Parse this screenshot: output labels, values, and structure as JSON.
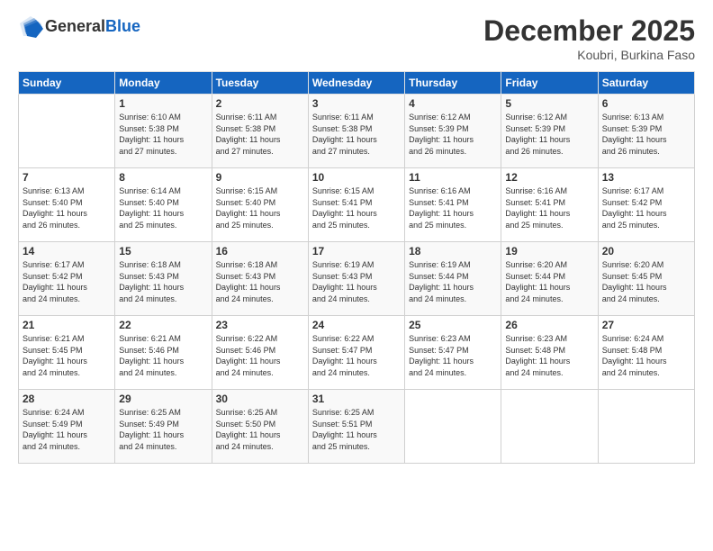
{
  "logo": {
    "general": "General",
    "blue": "Blue"
  },
  "header": {
    "month": "December 2025",
    "location": "Koubri, Burkina Faso"
  },
  "weekdays": [
    "Sunday",
    "Monday",
    "Tuesday",
    "Wednesday",
    "Thursday",
    "Friday",
    "Saturday"
  ],
  "weeks": [
    [
      {
        "day": "",
        "info": ""
      },
      {
        "day": "1",
        "info": "Sunrise: 6:10 AM\nSunset: 5:38 PM\nDaylight: 11 hours\nand 27 minutes."
      },
      {
        "day": "2",
        "info": "Sunrise: 6:11 AM\nSunset: 5:38 PM\nDaylight: 11 hours\nand 27 minutes."
      },
      {
        "day": "3",
        "info": "Sunrise: 6:11 AM\nSunset: 5:38 PM\nDaylight: 11 hours\nand 27 minutes."
      },
      {
        "day": "4",
        "info": "Sunrise: 6:12 AM\nSunset: 5:39 PM\nDaylight: 11 hours\nand 26 minutes."
      },
      {
        "day": "5",
        "info": "Sunrise: 6:12 AM\nSunset: 5:39 PM\nDaylight: 11 hours\nand 26 minutes."
      },
      {
        "day": "6",
        "info": "Sunrise: 6:13 AM\nSunset: 5:39 PM\nDaylight: 11 hours\nand 26 minutes."
      }
    ],
    [
      {
        "day": "7",
        "info": "Sunrise: 6:13 AM\nSunset: 5:40 PM\nDaylight: 11 hours\nand 26 minutes."
      },
      {
        "day": "8",
        "info": "Sunrise: 6:14 AM\nSunset: 5:40 PM\nDaylight: 11 hours\nand 25 minutes."
      },
      {
        "day": "9",
        "info": "Sunrise: 6:15 AM\nSunset: 5:40 PM\nDaylight: 11 hours\nand 25 minutes."
      },
      {
        "day": "10",
        "info": "Sunrise: 6:15 AM\nSunset: 5:41 PM\nDaylight: 11 hours\nand 25 minutes."
      },
      {
        "day": "11",
        "info": "Sunrise: 6:16 AM\nSunset: 5:41 PM\nDaylight: 11 hours\nand 25 minutes."
      },
      {
        "day": "12",
        "info": "Sunrise: 6:16 AM\nSunset: 5:41 PM\nDaylight: 11 hours\nand 25 minutes."
      },
      {
        "day": "13",
        "info": "Sunrise: 6:17 AM\nSunset: 5:42 PM\nDaylight: 11 hours\nand 25 minutes."
      }
    ],
    [
      {
        "day": "14",
        "info": "Sunrise: 6:17 AM\nSunset: 5:42 PM\nDaylight: 11 hours\nand 24 minutes."
      },
      {
        "day": "15",
        "info": "Sunrise: 6:18 AM\nSunset: 5:43 PM\nDaylight: 11 hours\nand 24 minutes."
      },
      {
        "day": "16",
        "info": "Sunrise: 6:18 AM\nSunset: 5:43 PM\nDaylight: 11 hours\nand 24 minutes."
      },
      {
        "day": "17",
        "info": "Sunrise: 6:19 AM\nSunset: 5:43 PM\nDaylight: 11 hours\nand 24 minutes."
      },
      {
        "day": "18",
        "info": "Sunrise: 6:19 AM\nSunset: 5:44 PM\nDaylight: 11 hours\nand 24 minutes."
      },
      {
        "day": "19",
        "info": "Sunrise: 6:20 AM\nSunset: 5:44 PM\nDaylight: 11 hours\nand 24 minutes."
      },
      {
        "day": "20",
        "info": "Sunrise: 6:20 AM\nSunset: 5:45 PM\nDaylight: 11 hours\nand 24 minutes."
      }
    ],
    [
      {
        "day": "21",
        "info": "Sunrise: 6:21 AM\nSunset: 5:45 PM\nDaylight: 11 hours\nand 24 minutes."
      },
      {
        "day": "22",
        "info": "Sunrise: 6:21 AM\nSunset: 5:46 PM\nDaylight: 11 hours\nand 24 minutes."
      },
      {
        "day": "23",
        "info": "Sunrise: 6:22 AM\nSunset: 5:46 PM\nDaylight: 11 hours\nand 24 minutes."
      },
      {
        "day": "24",
        "info": "Sunrise: 6:22 AM\nSunset: 5:47 PM\nDaylight: 11 hours\nand 24 minutes."
      },
      {
        "day": "25",
        "info": "Sunrise: 6:23 AM\nSunset: 5:47 PM\nDaylight: 11 hours\nand 24 minutes."
      },
      {
        "day": "26",
        "info": "Sunrise: 6:23 AM\nSunset: 5:48 PM\nDaylight: 11 hours\nand 24 minutes."
      },
      {
        "day": "27",
        "info": "Sunrise: 6:24 AM\nSunset: 5:48 PM\nDaylight: 11 hours\nand 24 minutes."
      }
    ],
    [
      {
        "day": "28",
        "info": "Sunrise: 6:24 AM\nSunset: 5:49 PM\nDaylight: 11 hours\nand 24 minutes."
      },
      {
        "day": "29",
        "info": "Sunrise: 6:25 AM\nSunset: 5:49 PM\nDaylight: 11 hours\nand 24 minutes."
      },
      {
        "day": "30",
        "info": "Sunrise: 6:25 AM\nSunset: 5:50 PM\nDaylight: 11 hours\nand 24 minutes."
      },
      {
        "day": "31",
        "info": "Sunrise: 6:25 AM\nSunset: 5:51 PM\nDaylight: 11 hours\nand 25 minutes."
      },
      {
        "day": "",
        "info": ""
      },
      {
        "day": "",
        "info": ""
      },
      {
        "day": "",
        "info": ""
      }
    ]
  ]
}
